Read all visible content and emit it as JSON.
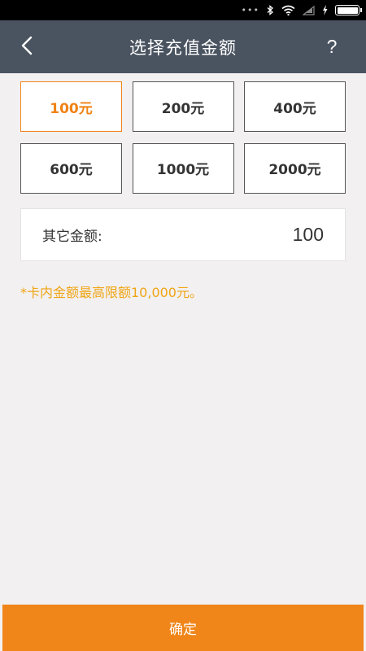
{
  "header": {
    "title": "选择充值金额"
  },
  "amounts": [
    {
      "label": "100元",
      "selected": true
    },
    {
      "label": "200元",
      "selected": false
    },
    {
      "label": "400元",
      "selected": false
    },
    {
      "label": "600元",
      "selected": false
    },
    {
      "label": "1000元",
      "selected": false
    },
    {
      "label": "2000元",
      "selected": false
    }
  ],
  "other_amount": {
    "label": "其它金额:",
    "value": "100"
  },
  "note": "*卡内金额最高限额10,000元。",
  "confirm_label": "确定",
  "help_label": "?",
  "icons": {
    "back": "chevron-left-icon",
    "bluetooth": "bluetooth-icon",
    "wifi": "wifi-icon",
    "signal": "signal-icon",
    "charging": "charging-icon",
    "battery": "battery-icon"
  },
  "colors": {
    "accent": "#f08519",
    "title_bar": "#4a5360",
    "note": "#f0a514",
    "background": "#f2f0f1"
  }
}
